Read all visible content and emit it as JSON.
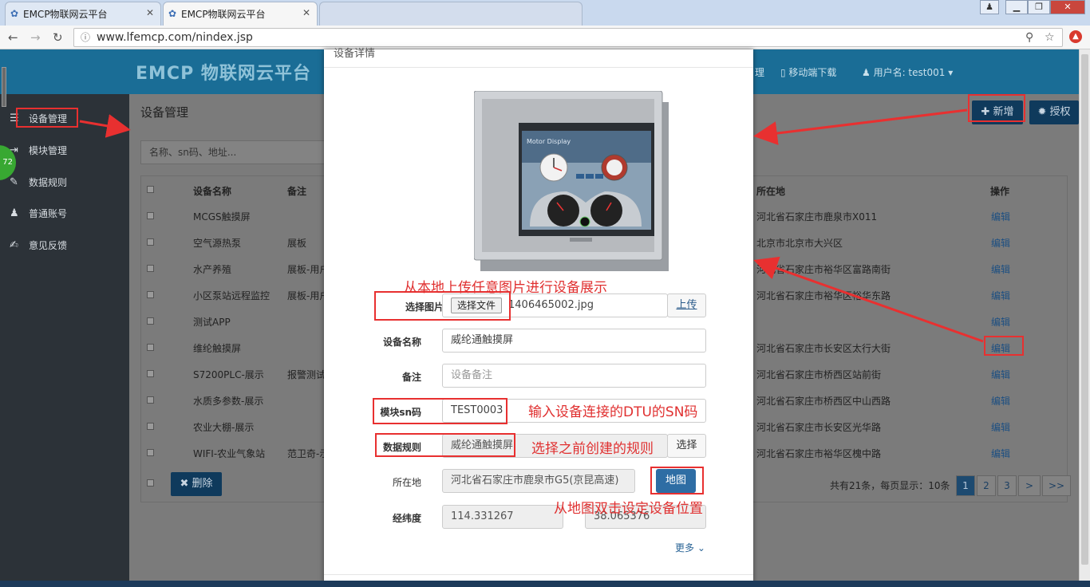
{
  "browser": {
    "tabs": [
      {
        "title": "EMCP物联网云平台"
      },
      {
        "title": "EMCP物联网云平台"
      }
    ],
    "url": "www.lfemcp.com/nindex.jsp"
  },
  "header": {
    "logo": "EMCP 物联网云平台",
    "partial_nav": "理",
    "mobile_download": "移动端下载",
    "user": "用户名: test001"
  },
  "sidebar": {
    "items": [
      {
        "label": "设备管理",
        "icon": "list-icon"
      },
      {
        "label": "模块管理",
        "icon": "module-icon"
      },
      {
        "label": "数据规则",
        "icon": "pencil-icon"
      },
      {
        "label": "普通账号",
        "icon": "user-icon"
      },
      {
        "label": "意见反馈",
        "icon": "edit-icon"
      }
    ],
    "badge": "72"
  },
  "main": {
    "title": "设备管理",
    "search_placeholder": "名称、sn码、地址...",
    "add_button": "新增",
    "auth_button": "授权",
    "delete_button": "删除",
    "columns": {
      "name": "设备名称",
      "remark": "备注",
      "location": "所在地",
      "action": "操作"
    },
    "rows": [
      {
        "name": "MCGS触摸屏",
        "remark": "",
        "location": "河北省石家庄市鹿泉市X011",
        "action": "编辑"
      },
      {
        "name": "空气源热泵",
        "remark": "展板",
        "location": "北京市北京市大兴区",
        "action": "编辑"
      },
      {
        "name": "水产养殖",
        "remark": "展板-用户",
        "location": "河北省石家庄市裕华区富路南街",
        "action": "编辑"
      },
      {
        "name": "小区泵站远程监控",
        "remark": "展板-用户",
        "location": "河北省石家庄市裕华区裕华东路",
        "action": "编辑"
      },
      {
        "name": "测试APP",
        "remark": "",
        "location": "",
        "action": "编辑"
      },
      {
        "name": "维纶触摸屏",
        "remark": "",
        "location": "河北省石家庄市长安区太行大街",
        "action": "编辑"
      },
      {
        "name": "S7200PLC-展示",
        "remark": "报警测试",
        "location": "河北省石家庄市桥西区站前街",
        "action": "编辑"
      },
      {
        "name": "水质多参数-展示",
        "remark": "",
        "location": "河北省石家庄市桥西区中山西路",
        "action": "编辑"
      },
      {
        "name": "农业大棚-展示",
        "remark": "",
        "location": "河北省石家庄市长安区光华路",
        "action": "编辑"
      },
      {
        "name": "WIFI-农业气象站",
        "remark": "范卫奇-示",
        "location": "河北省石家庄市裕华区槐中路",
        "action": "编辑"
      }
    ],
    "pagination_info": "共有21条，每页显示：10条",
    "pages": [
      "1",
      "2",
      "3",
      ">",
      ">>"
    ]
  },
  "modal": {
    "title_partial": "设备详情",
    "image_label": "选择图片",
    "file_button": "选择文件",
    "file_name": "1406465002.jpg",
    "upload_button": "上传",
    "name_label": "设备名称",
    "name_value": "威纶通触摸屏",
    "remark_label": "备注",
    "remark_placeholder": "设备备注",
    "sn_label": "模块sn码",
    "sn_value": "TEST0003",
    "rule_label": "数据规则",
    "rule_value": "威纶通触摸屏",
    "rule_button": "选择",
    "location_label": "所在地",
    "location_value": "河北省石家庄市鹿泉市G5(京昆高速)",
    "map_button": "地图",
    "coord_label": "经纬度",
    "longitude": "114.331267",
    "latitude": "38.065376",
    "more": "更多",
    "screen_title": "Motor Display"
  },
  "annotations": {
    "upload_note": "从本地上传任意图片进行设备展示",
    "sn_note": "输入设备连接的DTU的SN码",
    "rule_note": "选择之前创建的规则",
    "map_note": "从地图双击设定设备位置"
  },
  "colors": {
    "header": "#1a6d96",
    "sidebar": "#2c3238",
    "primary_button": "#2e6da4",
    "annotation_red": "#e83030"
  }
}
